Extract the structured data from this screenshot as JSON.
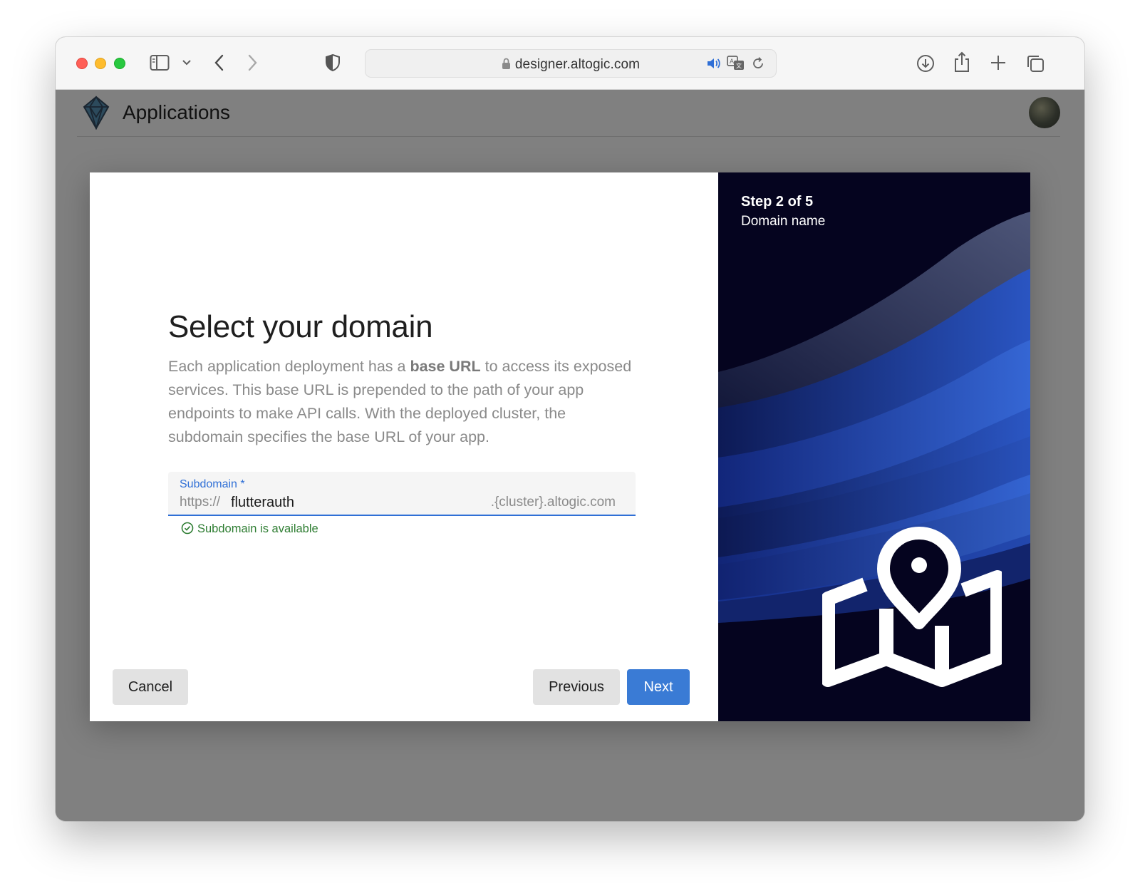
{
  "browser": {
    "url": "designer.altogic.com"
  },
  "app": {
    "title": "Applications"
  },
  "modal": {
    "title": "Select your domain",
    "description_before": "Each application deployment has a ",
    "description_bold": "base URL",
    "description_after": " to access its exposed services. This base URL is prepended to the path of your app endpoints to make API calls. With the deployed cluster, the subdomain specifies the base URL of your app.",
    "field": {
      "label": "Subdomain *",
      "prefix": "https://",
      "value": "flutterauth",
      "suffix": ".{cluster}.altogic.com"
    },
    "helper": "Subdomain is available",
    "buttons": {
      "cancel": "Cancel",
      "previous": "Previous",
      "next": "Next"
    },
    "side": {
      "step": "Step 2 of 5",
      "subtitle": "Domain name"
    }
  },
  "icons": [
    "sidebar-icon",
    "chevron-down-icon",
    "back-icon",
    "forward-icon",
    "shield-icon",
    "lock-icon",
    "speaker-icon",
    "translate-icon",
    "reload-icon",
    "download-icon",
    "share-icon",
    "new-tab-icon",
    "tabs-icon",
    "altogic-logo-icon",
    "check-circle-icon",
    "map-pin-icon"
  ],
  "colors": {
    "accent": "#3a7bd5",
    "success": "#2e7d32",
    "side_panel": "#05041f"
  }
}
